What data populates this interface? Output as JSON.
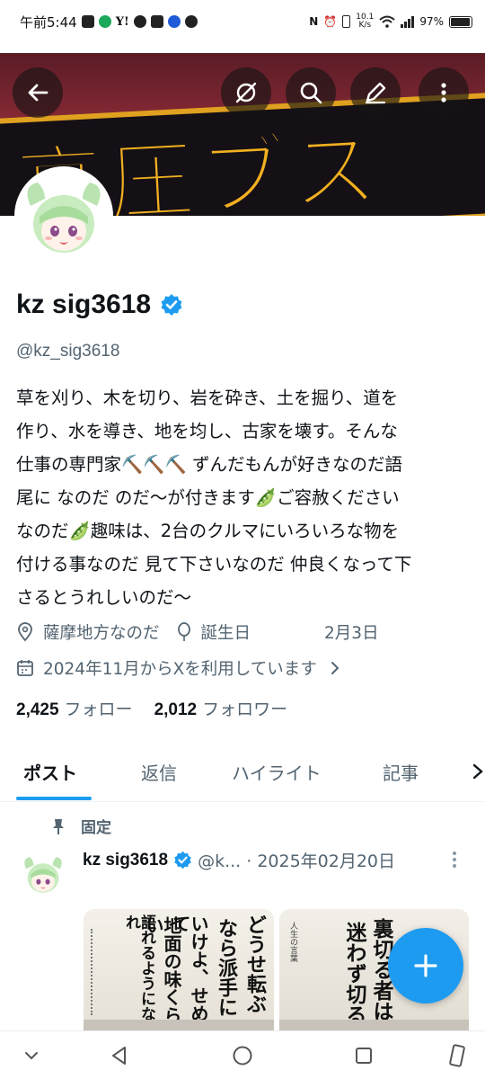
{
  "status_bar": {
    "time": "午前5:44",
    "yahoo": "Y!",
    "net_speed_value": "10.1",
    "net_speed_unit": "K/s",
    "battery": "97%"
  },
  "header": {
    "banner_text": "高圧ブス",
    "back_icon": "arrow-left-icon",
    "grok_icon": "grok-icon",
    "search_icon": "search-icon",
    "edit_icon": "pencil-icon",
    "more_icon": "more-vertical-icon"
  },
  "profile": {
    "name": "kz sig3618",
    "handle": "@kz_sig3618",
    "bio_lines": [
      "草を刈り、木を切り、岩を砕き、土を掘り、道を",
      "作り、水を導き、地を均し、古家を壊す。そんな",
      "仕事の専門家⛏️⛏️⛏️ ずんだもんが好きなのだ語",
      "尾に なのだ のだ〜が付きます🫛ご容赦ください",
      "なのだ🫛趣味は、2台のクルマにいろいろな物を",
      "付ける事なのだ 見て下さいなのだ 仲良くなって下",
      "さるとうれしいのだ〜"
    ],
    "location": "薩摩地方なのだ",
    "birthday_label": "誕生日",
    "birthday_value": "2月3日",
    "joined": "2024年11月からXを利用しています",
    "following_count": "2,425",
    "following_label": "フォロー",
    "followers_count": "2,012",
    "followers_label": "フォロワー"
  },
  "tabs": [
    {
      "label": "ポスト",
      "active": true
    },
    {
      "label": "返信",
      "active": false
    },
    {
      "label": "ハイライト",
      "active": false
    },
    {
      "label": "記事",
      "active": false
    }
  ],
  "pinned_post": {
    "pinned_label": "固定",
    "author_name": "kz sig3618",
    "meta": "@k... · 2025年02月20日",
    "media_left_lines": [
      "どうせ転ぶ",
      "なら派手に",
      "いけよ、せめて",
      "地面の味くらい",
      "語れるようになれ"
    ],
    "media_right_lines": [
      "裏切る者は",
      "迷わず切る"
    ],
    "media_right_caption": "人生の言葉"
  },
  "colors": {
    "accent": "#1d9bf0",
    "text_primary": "#0f1419",
    "text_secondary": "#536471",
    "banner_gold": "#f2b020"
  }
}
